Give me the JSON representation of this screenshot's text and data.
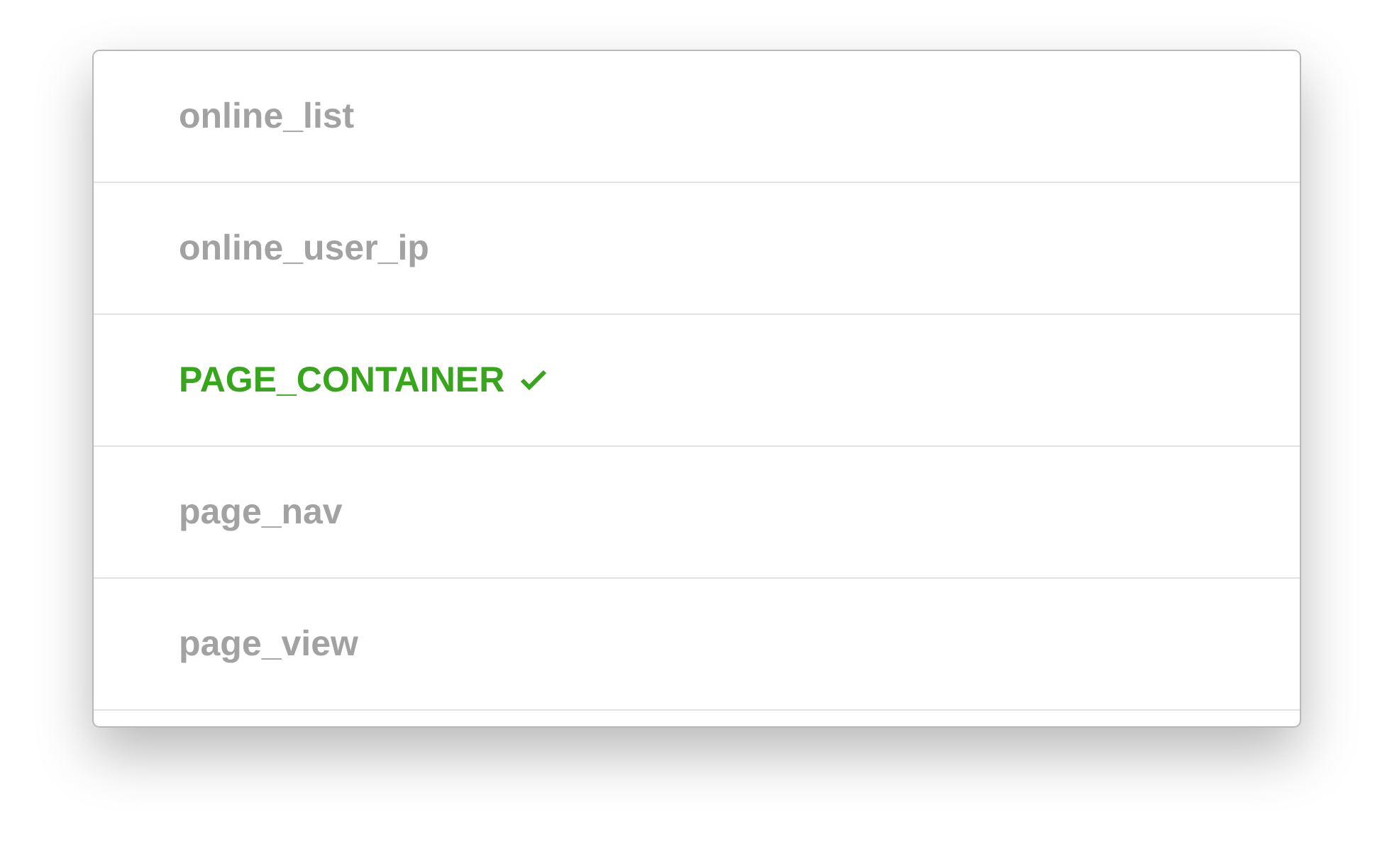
{
  "list": {
    "items": [
      {
        "label": "online_list",
        "selected": false
      },
      {
        "label": "online_user_ip",
        "selected": false
      },
      {
        "label": "PAGE_CONTAINER",
        "selected": true
      },
      {
        "label": "page_nav",
        "selected": false
      },
      {
        "label": "page_view",
        "selected": false
      }
    ]
  }
}
